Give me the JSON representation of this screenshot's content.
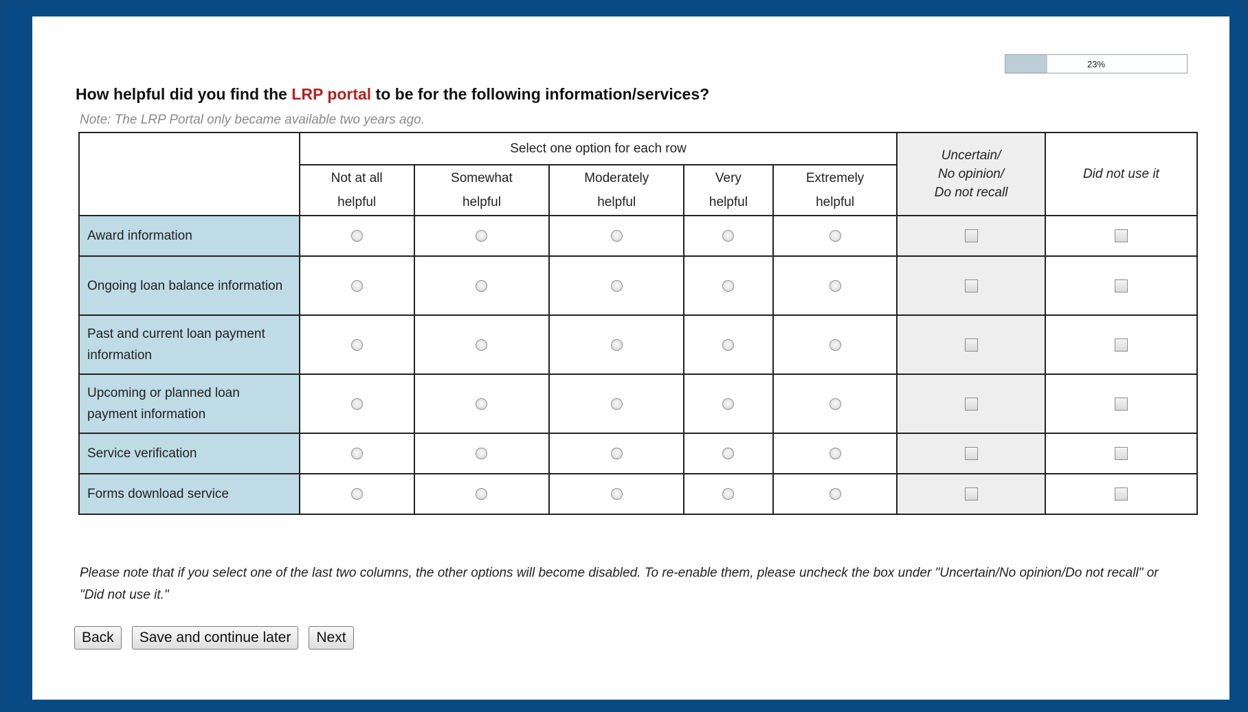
{
  "progress": {
    "value": 0.23,
    "label": "23%"
  },
  "question": {
    "prefix": "How helpful did you find the ",
    "highlight": "LRP portal",
    "suffix": " to be for the following information/services?",
    "highlight_color": "#b22222"
  },
  "note": "Note: The LRP Portal only became available two years ago.",
  "grid": {
    "group_header": "Select one option for each row",
    "columns": [
      {
        "line1": "Not at all",
        "line2": "helpful"
      },
      {
        "line1": "Somewhat",
        "line2": "helpful"
      },
      {
        "line1": "Moderately",
        "line2": "helpful"
      },
      {
        "line1": "Very",
        "line2": "helpful"
      },
      {
        "line1": "Extremely",
        "line2": "helpful"
      }
    ],
    "uncertain_header": {
      "line1": "Uncertain/",
      "line2": "No opinion/",
      "line3": "Do not recall"
    },
    "did_not_use_header": "Did not use it",
    "rows": [
      {
        "label": "Award information"
      },
      {
        "label": "Ongoing loan balance information"
      },
      {
        "label": "Past and current loan payment information"
      },
      {
        "label": "Upcoming or planned loan payment information"
      },
      {
        "label": "Service verification"
      },
      {
        "label": "Forms download service"
      }
    ]
  },
  "footnote": "Please note that if you select one of the last two columns, the other options will become disabled. To re-enable them, please uncheck the box under \"Uncertain/No opinion/Do not recall\" or \"Did not use it.\"",
  "buttons": {
    "back": "Back",
    "save": "Save and continue later",
    "next": "Next"
  },
  "colors": {
    "frame": "#074a85",
    "row_label_bg": "#bedbe6",
    "grey_column_bg": "#eeeeee",
    "progress_fill": "#bccdd8"
  }
}
